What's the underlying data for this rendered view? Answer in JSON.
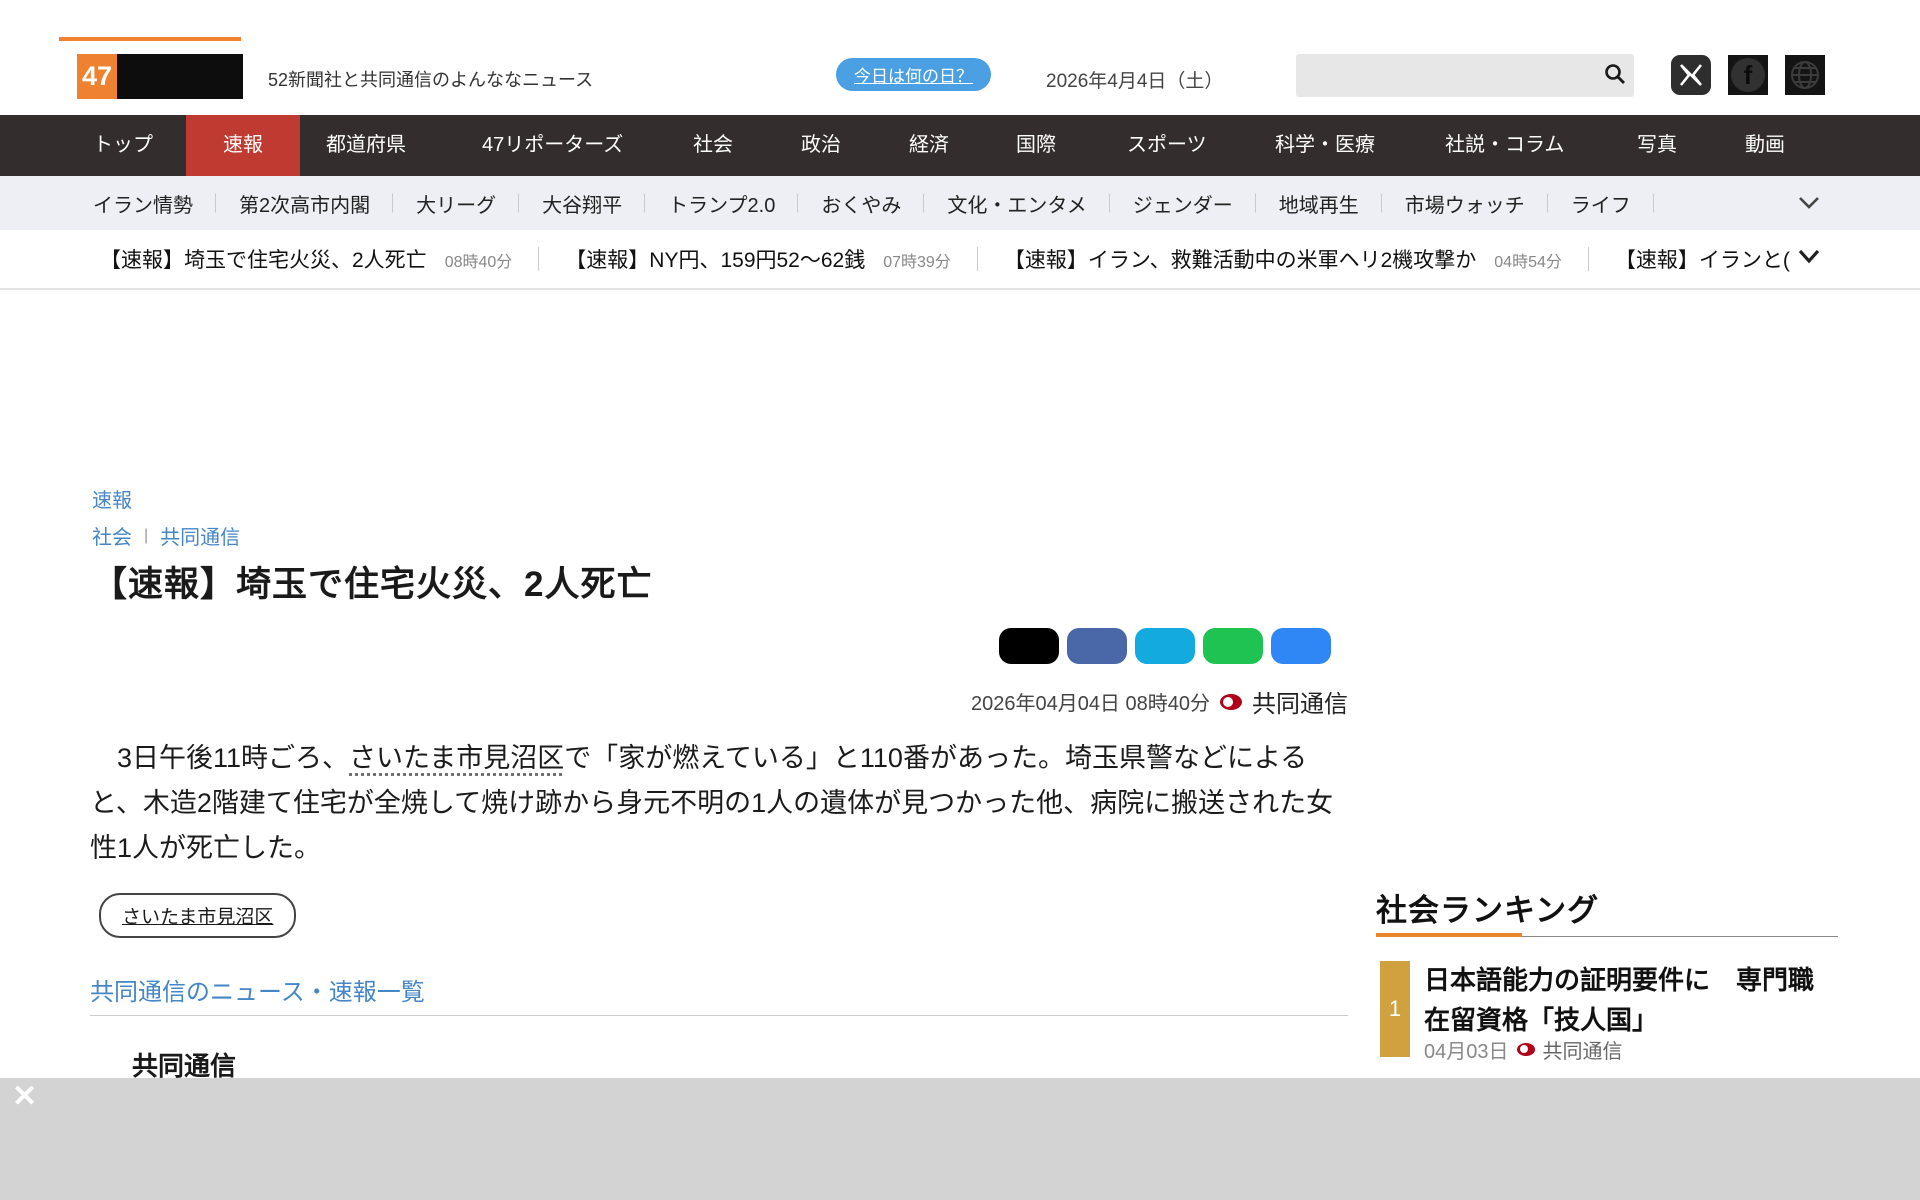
{
  "colors": {
    "accent_orange": "#ef8230",
    "nav_bg": "#332d2d",
    "nav_active_red": "#bf3a30",
    "subnav_bg": "#edeff4",
    "link_blue": "#4486c6",
    "today_pill_blue": "#4aa0e2",
    "kyodo_red": "#b0001a",
    "rank_gold": "#d0a23f",
    "rank_rule_orange": "#e8862e",
    "overlay_gray": "#d3d3d3"
  },
  "header": {
    "logo_number": "47",
    "tagline": "52新聞社と共同通信のよんななニュース",
    "today_button_label": "今日は何の日？",
    "date_label": "2026年4月4日（土）"
  },
  "nav": {
    "items": [
      {
        "label": "トップ"
      },
      {
        "label": "速報",
        "active": true
      },
      {
        "label": "都道府県"
      },
      {
        "label": "47リポーターズ"
      },
      {
        "label": "社会"
      },
      {
        "label": "政治"
      },
      {
        "label": "経済"
      },
      {
        "label": "国際"
      },
      {
        "label": "スポーツ"
      },
      {
        "label": "科学・医療"
      },
      {
        "label": "社説・コラム"
      },
      {
        "label": "写真"
      },
      {
        "label": "動画"
      }
    ]
  },
  "subnav": {
    "items": [
      {
        "label": "イラン情勢"
      },
      {
        "label": "第2次高市内閣"
      },
      {
        "label": "大リーグ"
      },
      {
        "label": "大谷翔平"
      },
      {
        "label": "トランプ2.0"
      },
      {
        "label": "おくやみ"
      },
      {
        "label": "文化・エンタメ"
      },
      {
        "label": "ジェンダー"
      },
      {
        "label": "地域再生"
      },
      {
        "label": "市場ウォッチ"
      },
      {
        "label": "ライフ"
      }
    ]
  },
  "ticker": {
    "items": [
      {
        "title": "【速報】埼玉で住宅火災、2人死亡",
        "time": "08時40分"
      },
      {
        "title": "【速報】NY円、159円52～62銭",
        "time": "07時39分"
      },
      {
        "title": "【速報】イラン、救難活動中の米軍ヘリ2機攻撃か",
        "time": "04時54分"
      },
      {
        "title": "【速報】イランと(",
        "time": ""
      }
    ]
  },
  "article": {
    "breadcrumb_section": "速報",
    "category": "社会",
    "category_divider": "|",
    "source": "共同通信",
    "title": "【速報】埼玉で住宅火災、2人死亡",
    "datetime": "2026年04月04日 08時40分",
    "source_label": "共同通信",
    "body_before_link": "　3日午後11時ごろ、",
    "body_link": "さいたま市見沼区",
    "body_after_link": "で「家が燃えている」と110番があった。埼玉県警などによると、木造2階建て住宅が全焼して焼け跡から身元不明の1人の遺体が見つかった他、病院に搬送された女性1人が死亡した。",
    "tag": "さいたま市見沼区",
    "related_link": "共同通信のニュース・速報一覧",
    "clipped_heading": "共同通信"
  },
  "share": {
    "buttons": [
      {
        "name": "x",
        "color": "#000000"
      },
      {
        "name": "facebook",
        "color": "#4a68a8"
      },
      {
        "name": "twitter",
        "color": "#12aadf"
      },
      {
        "name": "line",
        "color": "#1ec351"
      },
      {
        "name": "blue",
        "color": "#2f87f6"
      }
    ]
  },
  "ranking": {
    "heading": "社会ランキング",
    "items": [
      {
        "rank": "1",
        "title": "日本語能力の証明要件に　専門職在留資格「技人国」",
        "date": "04月03日",
        "source": "共同通信"
      }
    ]
  },
  "overlay": {
    "close": "✕"
  }
}
